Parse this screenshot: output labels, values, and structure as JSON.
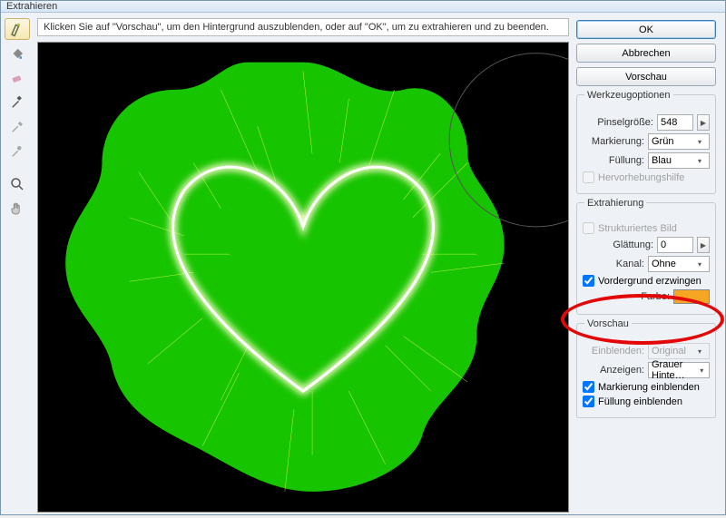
{
  "title": "Extrahieren",
  "hint": "Klicken Sie auf \"Vorschau\", um den Hintergrund auszublenden, oder auf \"OK\", um zu extrahieren und zu beenden.",
  "buttons": {
    "ok": "OK",
    "cancel": "Abbrechen",
    "preview": "Vorschau"
  },
  "toolOptions": {
    "legend": "Werkzeugoptionen",
    "brushSizeLabel": "Pinselgröße:",
    "brushSize": "548",
    "highlightLabel": "Markierung:",
    "highlight": "Grün",
    "fillLabel": "Füllung:",
    "fill": "Blau",
    "smartHighlight": "Hervorhebungshilfe"
  },
  "extraction": {
    "legend": "Extrahierung",
    "textured": "Strukturiertes Bild",
    "smoothLabel": "Glättung:",
    "smooth": "0",
    "channelLabel": "Kanal:",
    "channel": "Ohne",
    "forceFg": "Vordergrund erzwingen",
    "colorLabel": "Farbe:",
    "color": "#f5a623"
  },
  "preview": {
    "legend": "Vorschau",
    "showLabel": "Einblenden:",
    "show": "Original",
    "displayLabel": "Anzeigen:",
    "display": "Grauer Hinte…",
    "showHighlight": "Markierung einblenden",
    "showFill": "Füllung einblenden"
  }
}
